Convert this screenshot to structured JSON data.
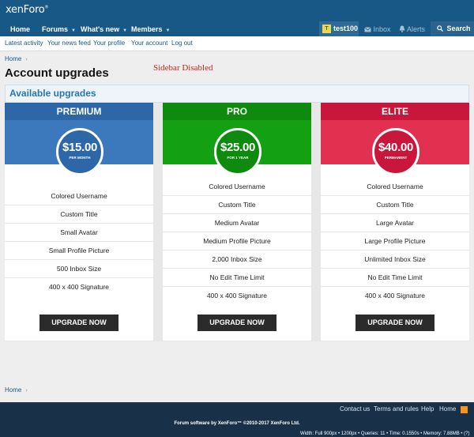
{
  "header": {
    "logo": "xenForo",
    "logo_mark": "®"
  },
  "nav": {
    "home": "Home",
    "forums": "Forums",
    "whats_new": "What's new",
    "members": "Members",
    "avatar_letter": "T",
    "username": "test100",
    "inbox": "Inbox",
    "alerts": "Alerts",
    "search": "Search"
  },
  "subnav": [
    "Latest activity",
    "Your news feed",
    "Your profile",
    "Your account",
    "Log out"
  ],
  "breadcrumb_top": "Home",
  "page_title": "Account upgrades",
  "sidebar_note": "Sidebar Disabled",
  "panel_title": "Available upgrades",
  "colors": {
    "premium_head": "#2d67a8",
    "premium_band": "#3b79bc",
    "pro_head": "#0e8a0e",
    "pro_band": "#13a013",
    "elite_head": "#c8173a",
    "elite_band": "#e23051"
  },
  "upgrades": [
    {
      "name": "PREMIUM",
      "price": "$15.00",
      "period": "PER MONTH",
      "features": [
        "Colored Username",
        "Custom Title",
        "Small Avatar",
        "Small Profile Picture",
        "500 Inbox Size",
        "400 x 400 Signature"
      ],
      "button": "UPGRADE NOW"
    },
    {
      "name": "PRO",
      "price": "$25.00",
      "period": "FOR 1 YEAR",
      "features": [
        "Colored Username",
        "Custom Title",
        "Medium Avatar",
        "Medium Profile Picture",
        "2,000 Inbox Size",
        "No Edit Time Limit",
        "400 x 400 Signature"
      ],
      "button": "UPGRADE NOW"
    },
    {
      "name": "ELITE",
      "price": "$40.00",
      "period": "PERMANENT",
      "features": [
        "Colored Username",
        "Custom Title",
        "Large Avatar",
        "Large Profile Picture",
        "Unlimited Inbox Size",
        "No Edit Time Limit",
        "400 x 400 Signature"
      ],
      "button": "UPGRADE NOW"
    }
  ],
  "breadcrumb_bottom": "Home",
  "footer": {
    "links": [
      "Contact us",
      "Terms and rules",
      "Help",
      "Home"
    ],
    "copyright": "Forum software by XenForo™ ©2010-2017 XenForo Ltd.",
    "stats": "Width: Full 900px • 1200px • Queries: 11 • Time: 0.1550s • Memory: 7.88MB • (?)"
  }
}
